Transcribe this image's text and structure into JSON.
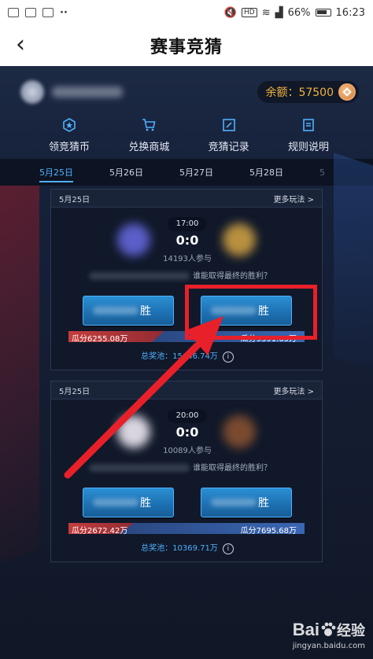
{
  "header": {
    "title": "赛事竞猜",
    "back_icon": "chevron-left-icon"
  },
  "statusbar": {
    "battery": "66%",
    "time": "16:23",
    "hd": "HD"
  },
  "user": {
    "balance_label": "余额：57500",
    "coin_icon": "coin-icon"
  },
  "nav": [
    {
      "label": "领竞猜币",
      "icon": "star-badge-icon"
    },
    {
      "label": "兑换商城",
      "icon": "cart-icon"
    },
    {
      "label": "竞猜记录",
      "icon": "record-icon"
    },
    {
      "label": "规则说明",
      "icon": "rules-icon"
    }
  ],
  "dates": [
    "5月25日",
    "5月26日",
    "5月27日",
    "5月28日"
  ],
  "matches": [
    {
      "date": "5月25日",
      "more": "更多玩法 >",
      "time": "17:00",
      "score": "0:0",
      "participants": "14193人参与",
      "question": "谁能取得最终的胜利？",
      "left_button": "胜",
      "right_button": "胜",
      "left_share": "瓜分6255.08万",
      "right_share": "瓜分9391.65万",
      "pool": "总奖池：15646.74万",
      "left_ratio": 0.4,
      "team_left_color": "#5a5ec8",
      "team_right_color": "#b89040"
    },
    {
      "date": "5月25日",
      "more": "更多玩法 >",
      "time": "20:00",
      "score": "0:0",
      "participants": "10089人参与",
      "question": "谁能取得最终的胜利？",
      "left_button": "胜",
      "right_button": "胜",
      "left_share": "瓜分2672.42万",
      "right_share": "瓜分7695.68万",
      "pool": "总奖池：10369.71万",
      "left_ratio": 0.26,
      "team_left_color": "#d9d5e0",
      "team_right_color": "#7a4a30"
    }
  ],
  "watermark": {
    "brand": "Bai",
    "paw": "paw-icon",
    "suffix": "经验",
    "url": "jingyan.baidu.com"
  },
  "colors": {
    "accent": "#4fb0ff",
    "gold": "#f2b33d",
    "annotation": "#e8202a"
  }
}
